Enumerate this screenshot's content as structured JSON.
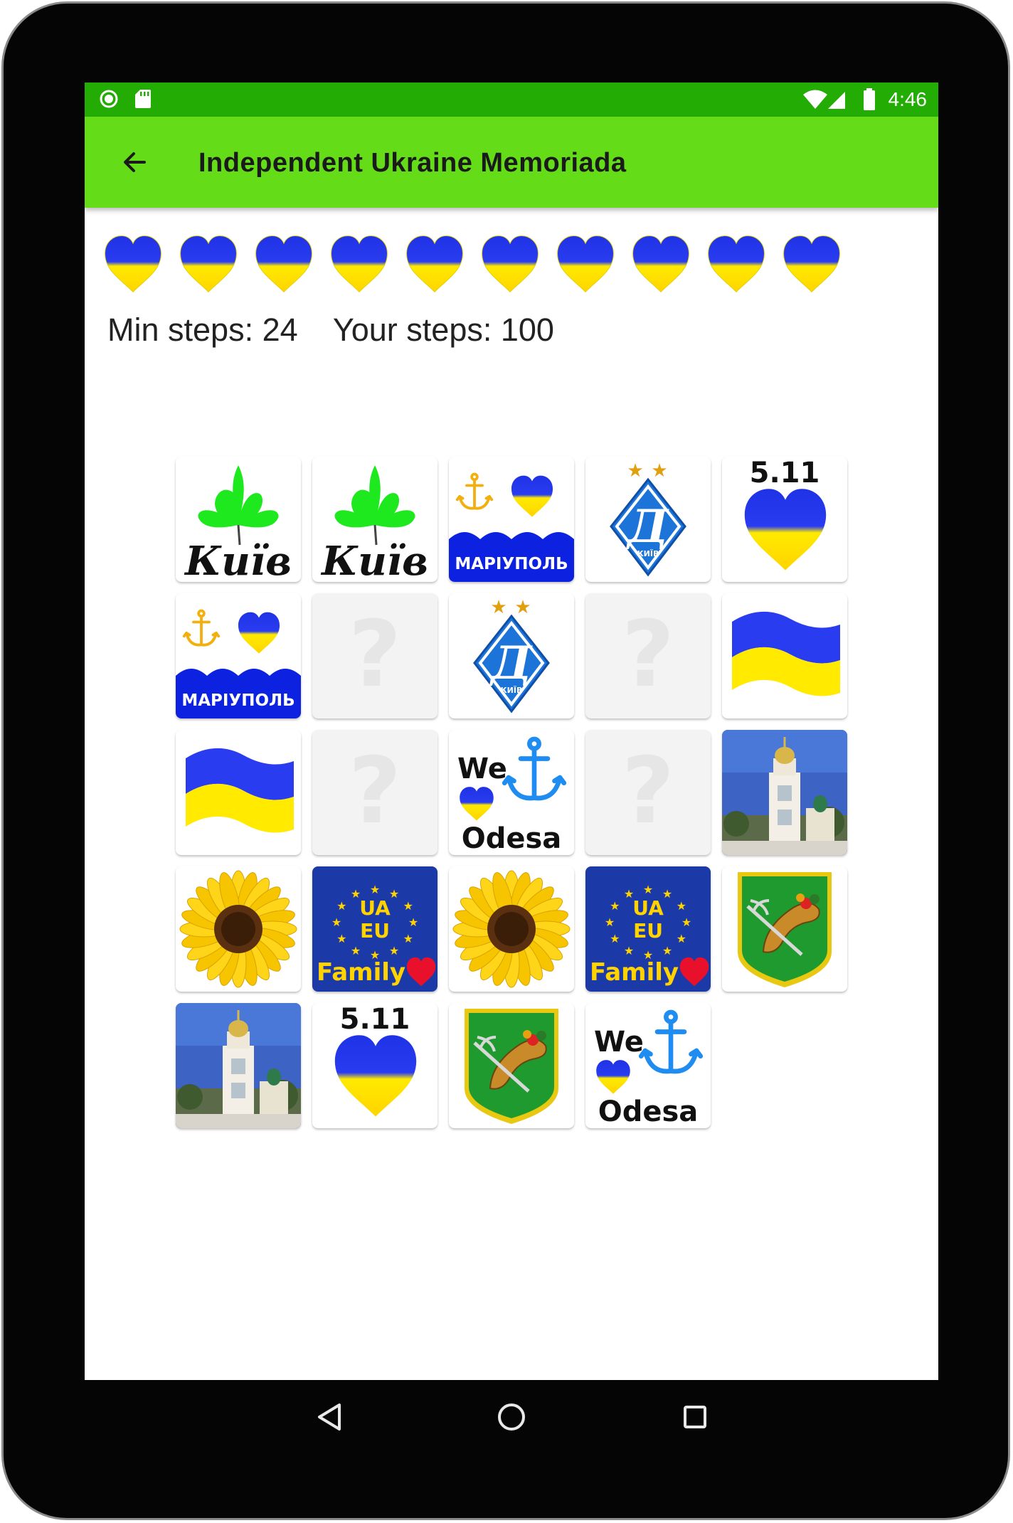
{
  "status_bar": {
    "time": "4:46",
    "left_icons": [
      "sync-icon",
      "sd-card-icon"
    ],
    "right_icons": [
      "wifi-icon",
      "signal-icon",
      "battery-icon"
    ]
  },
  "app_bar": {
    "title": "Independent Ukraine Memoriada",
    "back_icon": "arrow-left-icon"
  },
  "lives": {
    "count": 10,
    "icon": "ukraine-heart-icon"
  },
  "stats": {
    "min_steps_label": "Min steps:",
    "min_steps_value": "24",
    "your_steps_label": "Your steps:",
    "your_steps_value": "100"
  },
  "board": {
    "columns": 5,
    "rows": 5,
    "tiles": [
      {
        "card": "kyiv",
        "face_up": true
      },
      {
        "card": "kyiv",
        "face_up": true
      },
      {
        "card": "mariupol",
        "face_up": true
      },
      {
        "card": "dynamo",
        "face_up": true
      },
      {
        "card": "heart511",
        "face_up": true
      },
      {
        "card": "mariupol",
        "face_up": true
      },
      {
        "card": "hidden",
        "face_up": false
      },
      {
        "card": "dynamo",
        "face_up": true
      },
      {
        "card": "hidden",
        "face_up": false
      },
      {
        "card": "flag",
        "face_up": true
      },
      {
        "card": "flag",
        "face_up": true
      },
      {
        "card": "hidden",
        "face_up": false
      },
      {
        "card": "odesa",
        "face_up": true
      },
      {
        "card": "hidden",
        "face_up": false
      },
      {
        "card": "church",
        "face_up": true
      },
      {
        "card": "sunflower",
        "face_up": true
      },
      {
        "card": "uaeu",
        "face_up": true
      },
      {
        "card": "sunflower",
        "face_up": true
      },
      {
        "card": "uaeu",
        "face_up": true
      },
      {
        "card": "kharkiv",
        "face_up": true
      },
      {
        "card": "church",
        "face_up": true
      },
      {
        "card": "heart511",
        "face_up": true
      },
      {
        "card": "kharkiv",
        "face_up": true
      },
      {
        "card": "odesa",
        "face_up": true
      }
    ]
  },
  "card_texts": {
    "kyiv": "Київ",
    "mariupol": "МАРІУПОЛЬ",
    "dynamo": "КИЇВ",
    "heart511": "5.11",
    "odesa_we": "We",
    "odesa_name": "Odesa",
    "uaeu_ua": "UA",
    "uaeu_eu": "EU",
    "uaeu_family": "Family",
    "hidden": "?"
  },
  "colors": {
    "status_bar": "#22ac04",
    "app_bar": "#64dc18",
    "ukraine_blue": "#1f32e6",
    "ukraine_yellow": "#ffea00",
    "chestnut_green": "#1ee81e",
    "mariupol_blue": "#0d22e0",
    "anchor_gold": "#f2b010",
    "dynamo_blue": "#1c73d8",
    "odesa_anchor": "#1e8cf0",
    "eu_blue": "#1b3aa8",
    "eu_gold": "#ffd200",
    "kharkiv_green": "#1e9a2e",
    "hidden_mark": "#e6e6e6"
  },
  "nav_bar": {
    "icons": [
      "back-triangle-icon",
      "home-circle-icon",
      "recents-square-icon"
    ]
  }
}
